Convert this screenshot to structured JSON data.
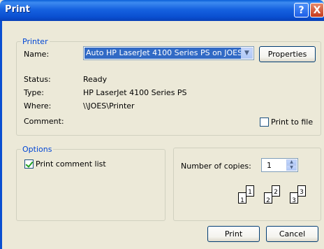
{
  "window": {
    "title": "Print",
    "help": "?",
    "close": "X"
  },
  "printer": {
    "legend": "Printer",
    "name_label": "Name:",
    "name_value": "Auto HP LaserJet 4100 Series PS on JOES",
    "properties_label": "Properties",
    "status_label": "Status:",
    "status_value": "Ready",
    "type_label": "Type:",
    "type_value": "HP LaserJet 4100 Series PS",
    "where_label": "Where:",
    "where_value": "\\\\JOES\\Printer",
    "comment_label": "Comment:",
    "print_to_file_label": "Print to file",
    "print_to_file_checked": false
  },
  "options": {
    "legend": "Options",
    "print_comment_list_label": "Print comment list",
    "print_comment_list_checked": true
  },
  "copies": {
    "label": "Number of copies:",
    "value": "1",
    "collate_pages": [
      "1",
      "1",
      "2",
      "2",
      "3",
      "3"
    ]
  },
  "buttons": {
    "print": "Print",
    "cancel": "Cancel"
  },
  "colors": {
    "titlebar": "#0a5fd8",
    "group_legend": "#0046d5",
    "selection": "#316ac5"
  }
}
